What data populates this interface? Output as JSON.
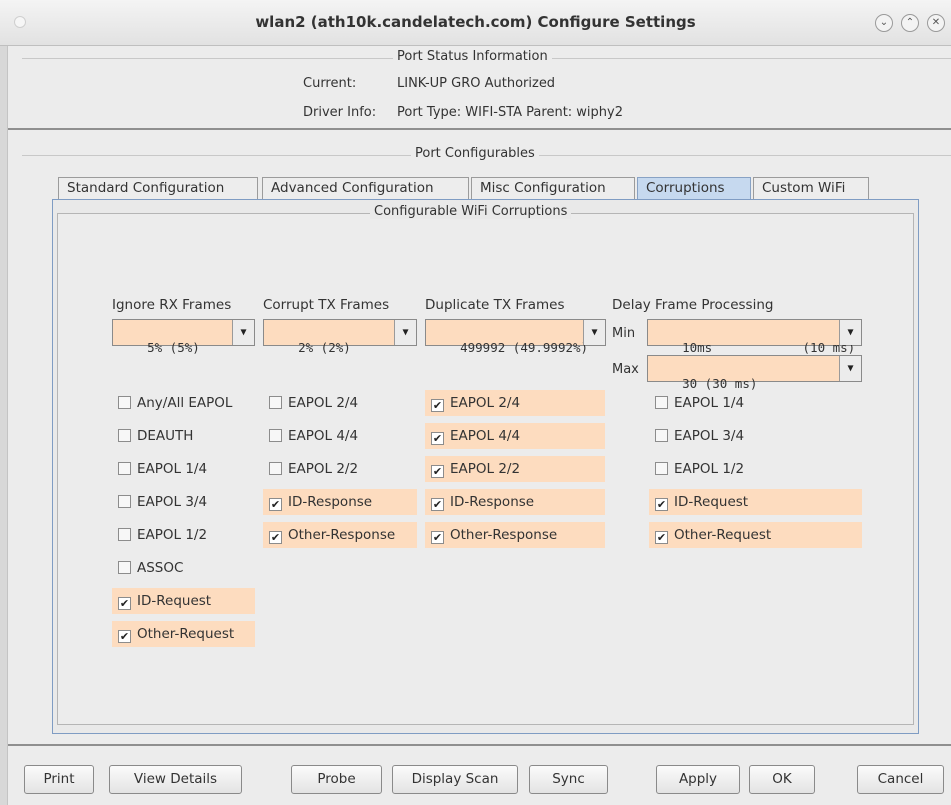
{
  "window": {
    "title": "wlan2  (ath10k.candelatech.com) Configure Settings"
  },
  "status": {
    "group_title": "Port Status Information",
    "current_label": "Current:",
    "current_value": "LINK-UP GRO  Authorized",
    "driver_label": "Driver Info:",
    "driver_value": "Port Type: WIFI-STA   Parent: wiphy2"
  },
  "configurables": {
    "group_title": "Port Configurables"
  },
  "tabs": [
    {
      "label": "Standard Configuration",
      "active": false
    },
    {
      "label": "Advanced Configuration",
      "active": false
    },
    {
      "label": "Misc Configuration",
      "active": false
    },
    {
      "label": "Corruptions",
      "active": true
    },
    {
      "label": "Custom WiFi",
      "active": false
    }
  ],
  "corruptions": {
    "title": "Configurable WiFi Corruptions",
    "ignore_rx": {
      "label": "Ignore RX Frames",
      "value": "5% (5%)"
    },
    "corrupt_tx": {
      "label": "Corrupt TX Frames",
      "value": "2% (2%)"
    },
    "duplicate_tx": {
      "label": "Duplicate TX Frames",
      "value": "499992 (49.9992%)"
    },
    "delay": {
      "label": "Delay Frame Processing",
      "min_label": "Min",
      "min_value": "10ms            (10 ms)",
      "max_label": "Max",
      "max_value": "30 (30 ms)"
    },
    "col1": [
      {
        "label": "Any/All EAPOL",
        "checked": false
      },
      {
        "label": "DEAUTH",
        "checked": false
      },
      {
        "label": "EAPOL 1/4",
        "checked": false
      },
      {
        "label": "EAPOL 3/4",
        "checked": false
      },
      {
        "label": "EAPOL 1/2",
        "checked": false
      },
      {
        "label": "ASSOC",
        "checked": false
      },
      {
        "label": "ID-Request",
        "checked": true
      },
      {
        "label": "Other-Request",
        "checked": true
      }
    ],
    "col2": [
      {
        "label": "EAPOL 2/4",
        "checked": false
      },
      {
        "label": "EAPOL 4/4",
        "checked": false
      },
      {
        "label": "EAPOL 2/2",
        "checked": false
      },
      {
        "label": "ID-Response",
        "checked": true
      },
      {
        "label": "Other-Response",
        "checked": true
      }
    ],
    "col3": [
      {
        "label": "EAPOL 2/4",
        "checked": true
      },
      {
        "label": "EAPOL 4/4",
        "checked": true
      },
      {
        "label": "EAPOL 2/2",
        "checked": true
      },
      {
        "label": "ID-Response",
        "checked": true
      },
      {
        "label": "Other-Response",
        "checked": true
      }
    ],
    "col4": [
      {
        "label": "EAPOL 1/4",
        "checked": false
      },
      {
        "label": "EAPOL 3/4",
        "checked": false
      },
      {
        "label": "EAPOL 1/2",
        "checked": false
      },
      {
        "label": "ID-Request",
        "checked": true
      },
      {
        "label": "Other-Request",
        "checked": true
      }
    ]
  },
  "buttons": {
    "print": "Print",
    "view_details": "View Details",
    "probe": "Probe",
    "display_scan": "Display Scan",
    "sync": "Sync",
    "apply": "Apply",
    "ok": "OK",
    "cancel": "Cancel"
  },
  "icons": {
    "check": "✔",
    "dropdown": "▼",
    "win_min": "⌄",
    "win_max": "⌃",
    "win_close": "✕"
  }
}
